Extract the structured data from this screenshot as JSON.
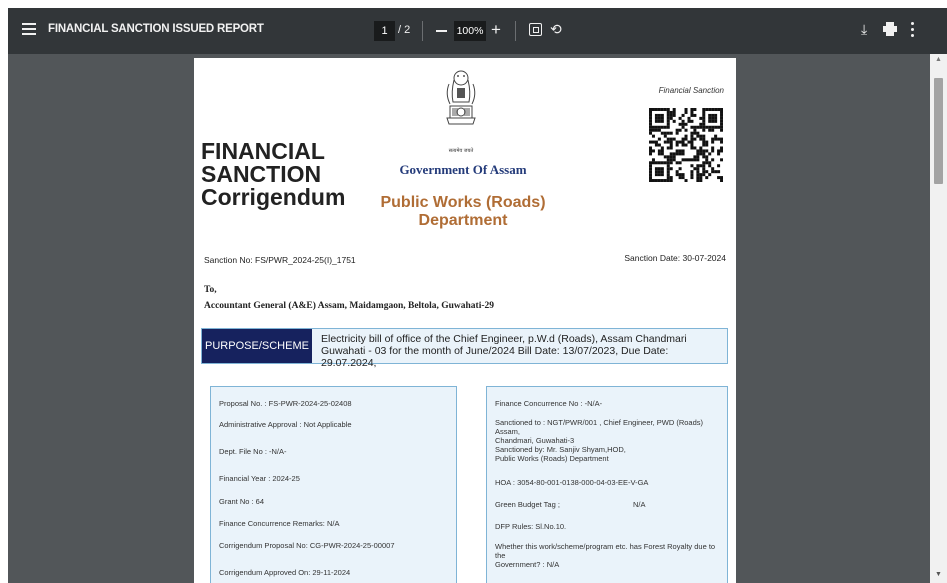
{
  "toolbar": {
    "title": "FINANCIAL SANCTION ISSUED REPORT",
    "current_page": "1",
    "total_pages": "/ 2",
    "zoom": "100%",
    "plus": "+",
    "rotate_glyph": "⟲",
    "download_glyph": "⤓",
    "icons": [
      "menu-icon",
      "zoom-out-icon",
      "zoom-in-icon",
      "fit-page-icon",
      "rotate-icon",
      "download-icon",
      "print-icon",
      "more-icon"
    ]
  },
  "colors": {
    "toolbar_bg": "#323639",
    "viewer_bg": "#525659",
    "purpose_label_bg": "#16225e",
    "panel_bg": "#eaf3fa",
    "panel_border": "#7fb4d6",
    "pwd_text": "#b06d35",
    "govt_text": "#243b7a"
  },
  "document": {
    "title_line1": "FINANCIAL",
    "title_line2": "SANCTION",
    "title_line3": "Corrigendum",
    "emblem_caption": "सत्यमेव जयते",
    "government": "Government Of Assam",
    "department_line1": "Public Works (Roads)",
    "department_line2": "Department",
    "tag": "Financial Sanction",
    "sanction_no": "Sanction No: FS/PWR_2024-25(I)_1751",
    "sanction_date": "Sanction Date: 30-07-2024",
    "to": "To,",
    "addressee": "Accountant General (A&E) Assam, Maidamgaon, Beltola, Guwahati-29",
    "purpose_label": "PURPOSE/SCHEME",
    "purpose_text": "Electricity bill of office of the Chief Engineer, p.W.d (Roads), Assam Chandmari Guwahati - 03 for the month of June/2024 Bill Date: 13/07/2023, Due Date: 29.07.2024,",
    "left_panel": {
      "proposal_no": "Proposal No. : FS-PWR-2024-25-02408",
      "admin_approval": "Administrative Approval : Not Applicable",
      "dept_file_no": "Dept. File No : -N/A-",
      "financial_year": "Financial Year : 2024-25",
      "grant_no": "Grant No : 64",
      "finance_remarks": "Finance Concurrence Remarks: N/A",
      "corrigendum_proposal_no": "Corrigendum Proposal No: CG-PWR-2024-25-00007",
      "corrigendum_approved_on": "Corrigendum Approved On: 29-11-2024"
    },
    "right_panel": {
      "finance_concurrence_no": "Finance Concurrence No : -N/A-",
      "sanctioned_to_1": "Sanctioned to : NGT/PWR/001 , Chief Engineer, PWD (Roads) Assam,",
      "sanctioned_to_2": "Chandmari, Guwahati-3",
      "sanctioned_by_1": "Sanctioned by: Mr. Sanjiv  Shyam,HOD,",
      "sanctioned_by_2": "Public Works (Roads) Department",
      "hoa": "HOA : 3054-80-001-0138-000-04-03-EE-V-GA",
      "green_budget_tag": "Green Budget Tag  ;",
      "green_budget_value": "N/A",
      "dfp_rules": "DFP Rules: Sl.No.10.",
      "forest_royalty_1": "Whether this work/scheme/program etc. has Forest Royalty due to the",
      "forest_royalty_2": "Government? : N/A"
    }
  }
}
